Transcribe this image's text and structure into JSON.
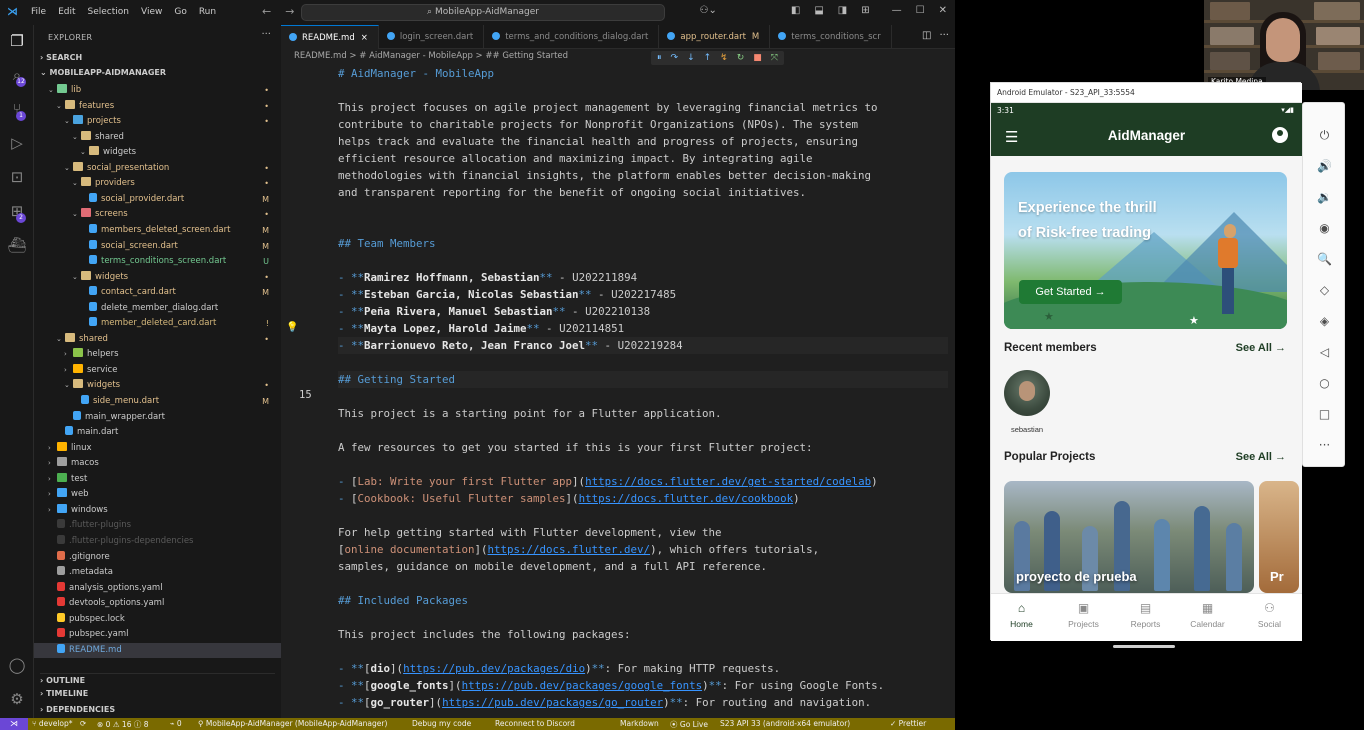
{
  "titlebar": {
    "menu": [
      "File",
      "Edit",
      "Selection",
      "View",
      "Go",
      "Run"
    ],
    "more": "···",
    "search": "MobileApp-AidManager"
  },
  "explorer": {
    "title": "EXPLORER",
    "search_section": "SEARCH",
    "root": "MOBILEAPP-AIDMANAGER",
    "items": [
      {
        "label": "lib",
        "depth": 1,
        "arrow": "v",
        "color": "#73c991",
        "status": "•",
        "scls": "c-mod"
      },
      {
        "label": "features",
        "depth": 2,
        "arrow": "v",
        "color": "#d7ba7d",
        "status": "•",
        "scls": "c-mod"
      },
      {
        "label": "projects",
        "depth": 3,
        "arrow": "v",
        "color": "#4aa3df",
        "status": "•",
        "scls": "c-mod"
      },
      {
        "label": "shared",
        "depth": 4,
        "arrow": "v",
        "color": "#d7ba7d",
        "status": "",
        "scls": ""
      },
      {
        "label": "widgets",
        "depth": 5,
        "arrow": "v",
        "color": "#d7ba7d",
        "status": "",
        "scls": ""
      },
      {
        "label": "social_presentation",
        "depth": 3,
        "arrow": "v",
        "color": "#d7ba7d",
        "status": "•",
        "scls": "c-mod"
      },
      {
        "label": "providers",
        "depth": 4,
        "arrow": "v",
        "color": "#d7ba7d",
        "status": "•",
        "scls": "c-mod"
      },
      {
        "label": "social_provider.dart",
        "depth": 5,
        "arrow": "",
        "color": "#42a5f5",
        "status": "M",
        "scls": "c-mod"
      },
      {
        "label": "screens",
        "depth": 4,
        "arrow": "v",
        "color": "#e06c75",
        "status": "•",
        "scls": "c-mod"
      },
      {
        "label": "members_deleted_screen.dart",
        "depth": 5,
        "arrow": "",
        "color": "#42a5f5",
        "status": "M",
        "scls": "c-mod"
      },
      {
        "label": "social_screen.dart",
        "depth": 5,
        "arrow": "",
        "color": "#42a5f5",
        "status": "M",
        "scls": "c-mod"
      },
      {
        "label": "terms_conditions_screen.dart",
        "depth": 5,
        "arrow": "",
        "color": "#42a5f5",
        "status": "U",
        "scls": "c-green"
      },
      {
        "label": "widgets",
        "depth": 4,
        "arrow": "v",
        "color": "#d7ba7d",
        "status": "•",
        "scls": "c-mod"
      },
      {
        "label": "contact_card.dart",
        "depth": 5,
        "arrow": "",
        "color": "#42a5f5",
        "status": "M",
        "scls": "c-mod"
      },
      {
        "label": "delete_member_dialog.dart",
        "depth": 5,
        "arrow": "",
        "color": "#42a5f5",
        "status": "",
        "scls": ""
      },
      {
        "label": "member_deleted_card.dart",
        "depth": 5,
        "arrow": "",
        "color": "#42a5f5",
        "status": "!",
        "scls": "c-yel"
      },
      {
        "label": "shared",
        "depth": 2,
        "arrow": "v",
        "color": "#d7ba7d",
        "status": "•",
        "scls": "c-mod"
      },
      {
        "label": "helpers",
        "depth": 3,
        "arrow": ">",
        "color": "#8bc34a",
        "status": "",
        "scls": ""
      },
      {
        "label": "service",
        "depth": 3,
        "arrow": ">",
        "color": "#ffb300",
        "status": "",
        "scls": ""
      },
      {
        "label": "widgets",
        "depth": 3,
        "arrow": "v",
        "color": "#d7ba7d",
        "status": "•",
        "scls": "c-mod"
      },
      {
        "label": "side_menu.dart",
        "depth": 4,
        "arrow": "",
        "color": "#42a5f5",
        "status": "M",
        "scls": "c-mod"
      },
      {
        "label": "main_wrapper.dart",
        "depth": 3,
        "arrow": "",
        "color": "#42a5f5",
        "status": "",
        "scls": ""
      },
      {
        "label": "main.dart",
        "depth": 2,
        "arrow": "",
        "color": "#42a5f5",
        "status": "",
        "scls": ""
      },
      {
        "label": "linux",
        "depth": 1,
        "arrow": ">",
        "color": "#ffb300",
        "status": "",
        "scls": ""
      },
      {
        "label": "macos",
        "depth": 1,
        "arrow": ">",
        "color": "#9e9e9e",
        "status": "",
        "scls": ""
      },
      {
        "label": "test",
        "depth": 1,
        "arrow": ">",
        "color": "#4caf50",
        "status": "",
        "scls": ""
      },
      {
        "label": "web",
        "depth": 1,
        "arrow": ">",
        "color": "#42a5f5",
        "status": "",
        "scls": ""
      },
      {
        "label": "windows",
        "depth": 1,
        "arrow": ">",
        "color": "#42a5f5",
        "status": "",
        "scls": ""
      },
      {
        "label": ".flutter-plugins",
        "depth": 1,
        "arrow": "",
        "color": "#3a3a3a",
        "status": "",
        "scls": "",
        "dim": true
      },
      {
        "label": ".flutter-plugins-dependencies",
        "depth": 1,
        "arrow": "",
        "color": "#3a3a3a",
        "status": "",
        "scls": "",
        "dim": true
      },
      {
        "label": ".gitignore",
        "depth": 1,
        "arrow": "",
        "color": "#e06c4a",
        "status": "",
        "scls": ""
      },
      {
        "label": ".metadata",
        "depth": 1,
        "arrow": "",
        "color": "#9e9e9e",
        "status": "",
        "scls": ""
      },
      {
        "label": "analysis_options.yaml",
        "depth": 1,
        "arrow": "",
        "color": "#e53935",
        "status": "",
        "scls": ""
      },
      {
        "label": "devtools_options.yaml",
        "depth": 1,
        "arrow": "",
        "color": "#e53935",
        "status": "",
        "scls": ""
      },
      {
        "label": "pubspec.lock",
        "depth": 1,
        "arrow": "",
        "color": "#ffca28",
        "status": "",
        "scls": ""
      },
      {
        "label": "pubspec.yaml",
        "depth": 1,
        "arrow": "",
        "color": "#e53935",
        "status": "",
        "scls": ""
      },
      {
        "label": "README.md",
        "depth": 1,
        "arrow": "",
        "color": "#42a5f5",
        "status": "",
        "scls": "",
        "selected": true,
        "blue": true
      }
    ],
    "outline": "OUTLINE",
    "timeline": "TIMELINE",
    "dependencies": "DEPENDENCIES"
  },
  "tabs": [
    {
      "label": "README.md",
      "active": true,
      "color": "#42a5f5",
      "status": "×"
    },
    {
      "label": "login_screen.dart",
      "color": "#42a5f5",
      "status": ""
    },
    {
      "label": "terms_and_conditions_dialog.dart",
      "color": "#42a5f5",
      "status": ""
    },
    {
      "label": "app_router.dart",
      "color": "#42a5f5",
      "status": "M",
      "modified": true
    },
    {
      "label": "terms_conditions_scr",
      "color": "#42a5f5",
      "status": ""
    }
  ],
  "breadcrumbs": "README.md  >  # AidManager - MobileApp  >  ## Getting Started",
  "debug_toolbar": [
    "⏸",
    "↷",
    "↓",
    "↑",
    "↯",
    "↻",
    "■",
    "⤧"
  ],
  "line_number": "15",
  "markdown": {
    "h1": "# AidManager - MobileApp",
    "intro": [
      "This project focuses on agile project management by leveraging financial metrics to",
      "contribute to charitable projects for Nonprofit Organizations (NPOs). The system",
      "helps track and evaluate the financial health and progress of projects, ensuring",
      "efficient resource allocation and maximizing impact. By integrating agile",
      "methodologies with financial insights, the platform enables better decision-making",
      "and transparent reporting for the benefit of ongoing social initiatives."
    ],
    "h2_team": "## Team Members",
    "team": [
      {
        "name": "Ramirez Hoffmann, Sebastian",
        "code": "U202211894"
      },
      {
        "name": "Esteban Garcia, Nicolas Sebastian",
        "code": "U202217485"
      },
      {
        "name": "Peña Rivera, Manuel Sebastian",
        "code": "U202210138"
      },
      {
        "name": "Mayta Lopez, Harold Jaime",
        "code": "U202114851"
      },
      {
        "name": "Barrionuevo Reto, Jean Franco Joel",
        "code": "U202219284"
      }
    ],
    "h2_started": "## Getting Started",
    "starting_point": "This project is a starting point for a Flutter application.",
    "few_resources": "A few resources to get you started if this is your first Flutter project:",
    "link1_text": "Lab: Write your first Flutter app",
    "link1_url": "https://docs.flutter.dev/get-started/codelab",
    "link2_text": "Cookbook: Useful Flutter samples",
    "link2_url": "https://docs.flutter.dev/cookbook",
    "help1": "For help getting started with Flutter development, view the",
    "help_link_text": "online documentation",
    "help_link_url": "https://docs.flutter.dev/",
    "help2_suffix": ", which offers tutorials,",
    "help3": "samples, guidance on mobile development, and a full API reference.",
    "h2_packages": "## Included Packages",
    "packages_intro": "This project includes the following packages:",
    "packages": [
      {
        "name": "dio",
        "url": "https://pub.dev/packages/dio",
        "desc": ": For making HTTP requests."
      },
      {
        "name": "google_fonts",
        "url": "https://pub.dev/packages/google_fonts",
        "desc": ": For using Google Fonts."
      },
      {
        "name": "go_router",
        "url": "https://pub.dev/packages/go_router",
        "desc": ": For routing and navigation."
      }
    ]
  },
  "statusbar": {
    "branch": "develop*",
    "sync": "⟳",
    "problems": "⊗ 0 ⚠ 16 ⓘ 8",
    "ports": "⌁ 0",
    "project": "MobileApp-AidManager (MobileApp-AidManager)",
    "debug": "Debug my code",
    "discord": "Reconnect to Discord",
    "lang": "Markdown",
    "golive": "Go Live",
    "device": "S23 API 33 (android-x64 emulator)",
    "prettier": "✓ Prettier"
  },
  "webcam": {
    "name": "Karito Medina"
  },
  "emulator": {
    "title": "Android Emulator - S23_API_33:5554",
    "time": "3:31",
    "status_icons": "▾◢▮",
    "app_title": "AidManager",
    "banner_title": "Experience the thrill of Risk-free trading",
    "banner_button": "Get Started →",
    "recent_members": "Recent members",
    "see_all": "See All →",
    "member_name": "sebastian",
    "popular_projects": "Popular Projects",
    "project1": "proyecto de prueba",
    "project2": "Pr",
    "nav": [
      {
        "label": "Home",
        "icon": "⌂",
        "active": true
      },
      {
        "label": "Projects",
        "icon": "▣"
      },
      {
        "label": "Reports",
        "icon": "▤"
      },
      {
        "label": "Calendar",
        "icon": "▦"
      },
      {
        "label": "Social",
        "icon": "⚇"
      }
    ],
    "tools": [
      "⏻",
      "🔊",
      "🔉",
      "◉",
      "🔍",
      "◇",
      "◈",
      "◁",
      "○",
      "□",
      "···"
    ]
  },
  "colors": {
    "accent": "#0078d4",
    "app_green": "#1e3d24",
    "status_bg": "#7a6a00",
    "remote": "#6b47d6"
  }
}
